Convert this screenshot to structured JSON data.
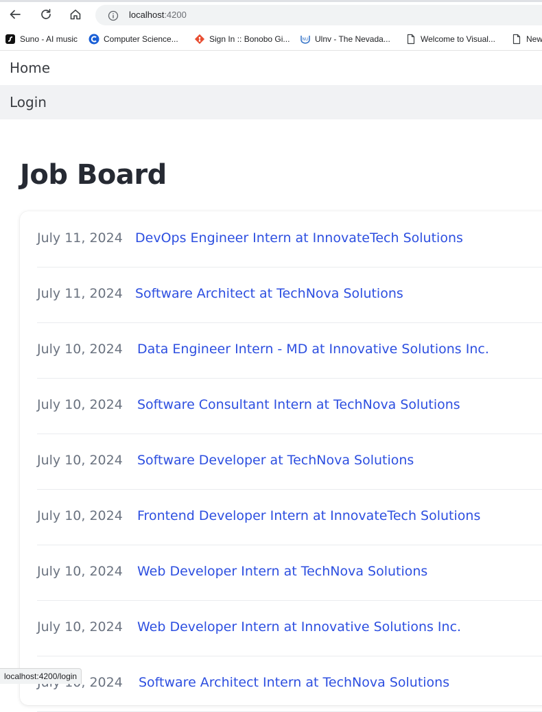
{
  "browser": {
    "url_host": "localhost",
    "url_port": ":4200",
    "bookmarks": [
      {
        "label": "Suno - AI music",
        "icon": "suno-icon"
      },
      {
        "label": "Computer Science...",
        "icon": "c-logo-icon"
      },
      {
        "label": "Sign In :: Bonobo Gi...",
        "icon": "git-icon"
      },
      {
        "label": "Ulnv - The Nevada...",
        "icon": "unlv-icon"
      },
      {
        "label": "Welcome to Visual...",
        "icon": "page-icon"
      },
      {
        "label": "New",
        "icon": "page-icon"
      }
    ],
    "status_url": "localhost:4200/login"
  },
  "nav": {
    "home_label": "Home",
    "login_label": "Login"
  },
  "page": {
    "title": "Job Board"
  },
  "jobs": [
    {
      "date": "July 11, 2024",
      "title": "DevOps Engineer Intern at InnovateTech Solutions"
    },
    {
      "date": "July 11, 2024",
      "title": "Software Architect at TechNova Solutions"
    },
    {
      "date": "July 10, 2024",
      "title": "Data Engineer Intern - MD at Innovative Solutions Inc."
    },
    {
      "date": "July 10, 2024",
      "title": "Software Consultant Intern at TechNova Solutions"
    },
    {
      "date": "July 10, 2024",
      "title": "Software Developer at TechNova Solutions"
    },
    {
      "date": "July 10, 2024",
      "title": "Frontend Developer Intern at InnovateTech Solutions"
    },
    {
      "date": "July 10, 2024",
      "title": "Web Developer Intern at TechNova Solutions"
    },
    {
      "date": "July 10, 2024",
      "title": "Web Developer Intern at Innovative Solutions Inc."
    },
    {
      "date": "July 10, 2024",
      "title": "Software Architect Intern at TechNova Solutions"
    }
  ],
  "colors": {
    "link": "#2d4fe0",
    "date": "#6b7380",
    "title": "#262a33"
  }
}
